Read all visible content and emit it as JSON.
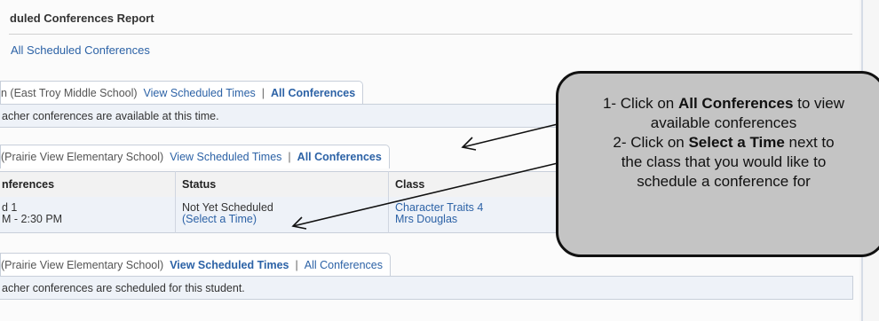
{
  "report": {
    "title": "duled Conferences Report",
    "all_scheduled_link": "All Scheduled Conferences"
  },
  "sections": [
    {
      "school": "n (East Troy Middle School)",
      "view_times": "View Scheduled Times",
      "separator": "|",
      "all_conferences": "All Conferences",
      "message": "acher conferences are available at this time."
    },
    {
      "school": "(Prairie View Elementary School)",
      "view_times": "View Scheduled Times",
      "separator": "|",
      "all_conferences": "All Conferences"
    },
    {
      "school": "(Prairie View Elementary School)",
      "view_times": "View Scheduled Times",
      "separator": "|",
      "all_conferences": "All Conferences",
      "message": "acher conferences are scheduled for this student."
    }
  ],
  "table": {
    "headers": [
      "nferences",
      "Status",
      "Class"
    ],
    "row": {
      "conference_line1": "d 1",
      "conference_line2": "M - 2:30 PM",
      "status": "Not Yet Scheduled",
      "select_time": "(Select a Time)",
      "class_name": "Character Traits 4",
      "teacher": "Mrs Douglas"
    }
  },
  "callout": {
    "line1_pre": "1- Click on ",
    "line1_bold": "All Conferences",
    "line1_post": " to view",
    "line2": "available conferences",
    "line3_pre": "2- Click on ",
    "line3_bold": "Select a Time",
    "line3_post": " next to",
    "line4": "the class that you would like to",
    "line5": "schedule a conference for"
  }
}
